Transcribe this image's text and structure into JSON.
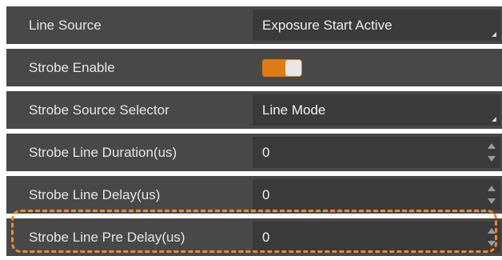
{
  "settings": {
    "line_source": {
      "label": "Line Source",
      "value": "Exposure Start Active"
    },
    "strobe_enable": {
      "label": "Strobe Enable",
      "enabled": true
    },
    "strobe_source_selector": {
      "label": "Strobe Source Selector",
      "value": "Line Mode"
    },
    "strobe_line_duration": {
      "label": "Strobe Line Duration(us)",
      "value": "0"
    },
    "strobe_line_delay": {
      "label": "Strobe Line Delay(us)",
      "value": "0"
    },
    "strobe_line_pre_delay": {
      "label": "Strobe Line Pre Delay(us)",
      "value": "0"
    }
  },
  "colors": {
    "row_background": "#484848",
    "control_background": "#3a3a3a",
    "toggle_on": "#e07a12",
    "highlight_border": "#f08a2a",
    "label_text": "#e6e6e6"
  }
}
